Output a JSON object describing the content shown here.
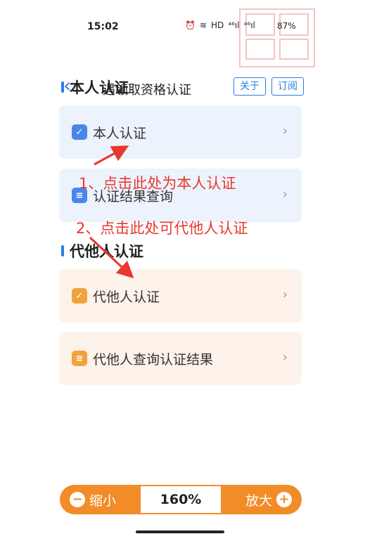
{
  "status_bar": {
    "time": "15:02",
    "icons": [
      "⏰",
      "≋",
      "HD",
      "⁴⁶ıl",
      "⁴⁶ıl"
    ],
    "battery": "87%"
  },
  "nav": {
    "title": "遇领取资格认证",
    "about_label": "关于",
    "subscribe_label": "订阅"
  },
  "sections": {
    "self": {
      "title": "本人认证",
      "items": [
        {
          "label": "本人认证",
          "icon": "person-check-icon",
          "icon_glyph": "✓"
        },
        {
          "label": "认证结果查询",
          "icon": "document-icon",
          "icon_glyph": "≡"
        }
      ]
    },
    "proxy": {
      "title": "代他人认证",
      "items": [
        {
          "label": "代他人认证",
          "icon": "person-check-icon",
          "icon_glyph": "✓"
        },
        {
          "label": "代他人查询认证结果",
          "icon": "document-icon",
          "icon_glyph": "≡"
        }
      ]
    }
  },
  "annotations": {
    "first": "1、点击此处为本人认证",
    "second": "2、点击此处可代他人认证"
  },
  "zoom": {
    "out_label": "缩小",
    "value": "160%",
    "in_label": "放大"
  },
  "colors": {
    "accent_blue": "#2b7de9",
    "accent_orange": "#f28c28",
    "annotation_red": "#e8382f"
  }
}
